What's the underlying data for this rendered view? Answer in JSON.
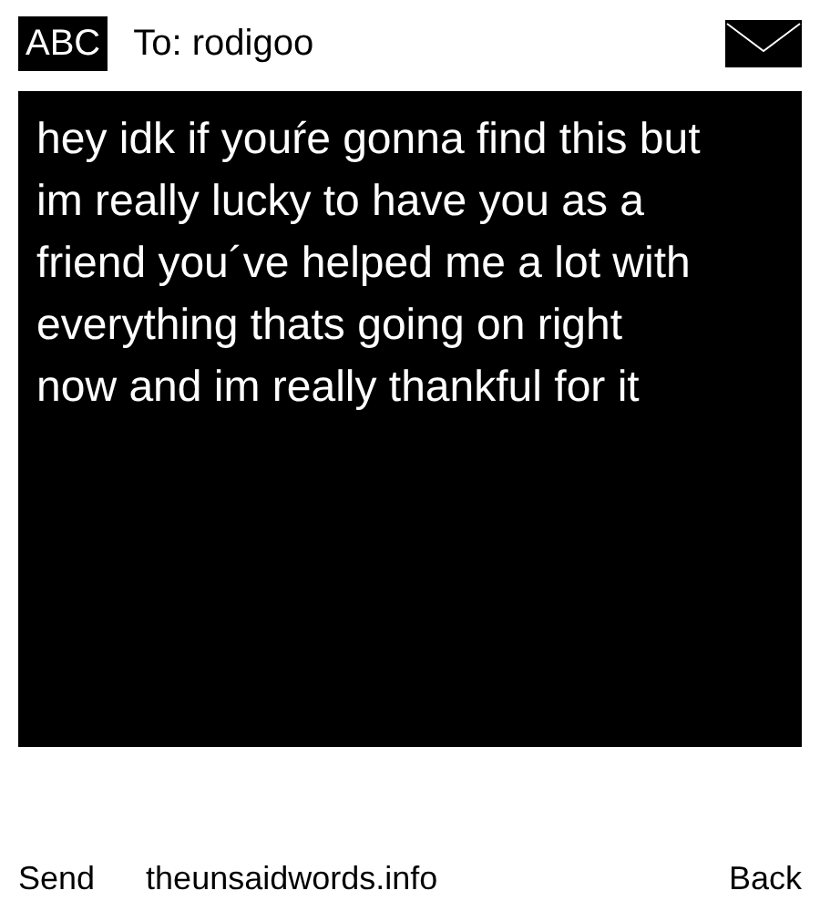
{
  "header": {
    "input_mode": "ABC",
    "recipient": "To: rodigoo"
  },
  "message": "hey idk if youŕe gonna find this but im really lucky to have you as a friend you´ve helped me a lot with everything thats going on right now and im really thankful for it",
  "softkeys": {
    "left": "Send",
    "center": "theunsaidwords.info",
    "right": "Back"
  }
}
